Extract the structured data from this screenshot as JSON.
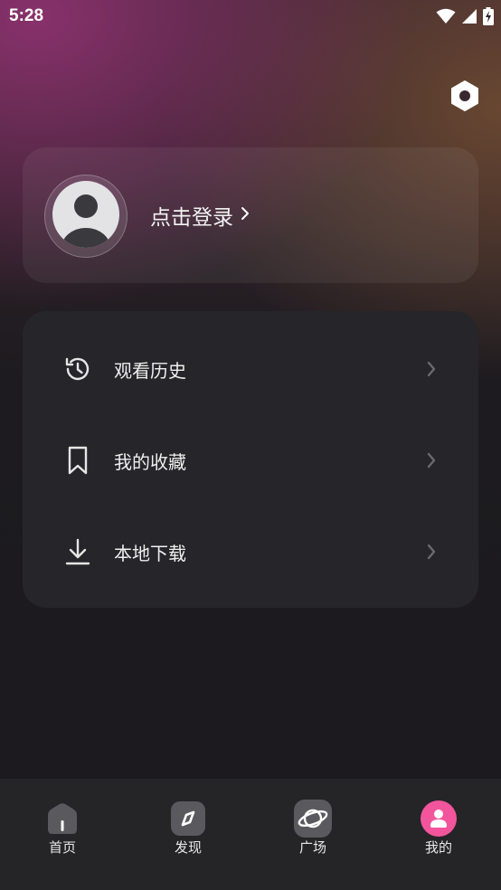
{
  "status_bar": {
    "time": "5:28",
    "icons": [
      "wifi-icon",
      "signal-icon",
      "battery-charging-icon"
    ]
  },
  "header": {
    "settings_icon": "settings-hexagon-icon"
  },
  "profile": {
    "avatar_icon": "default-avatar-icon",
    "login_label": "点击登录",
    "login_chevron_icon": "chevron-right-icon"
  },
  "menu": {
    "items": [
      {
        "icon": "history-icon",
        "label": "观看历史"
      },
      {
        "icon": "bookmark-icon",
        "label": "我的收藏"
      },
      {
        "icon": "download-icon",
        "label": "本地下载"
      }
    ]
  },
  "bottom_nav": {
    "items": [
      {
        "icon": "home-icon",
        "label": "首页",
        "active": false
      },
      {
        "icon": "compass-icon",
        "label": "发现",
        "active": false
      },
      {
        "icon": "planet-icon",
        "label": "广场",
        "active": false
      },
      {
        "icon": "user-icon",
        "label": "我的",
        "active": true
      }
    ]
  },
  "colors": {
    "accent_pink": "#f2559b",
    "card_bg": "#262529",
    "nav_bg": "#252427",
    "icon_gray": "#5a5a5e"
  }
}
